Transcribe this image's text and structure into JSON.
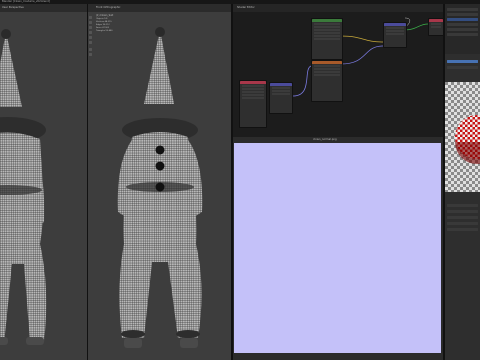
{
  "window": {
    "title": "Blender [Clown_Costume_v02.blend]"
  },
  "topbar": {
    "menus": [
      "File",
      "Edit",
      "Render",
      "Window",
      "Help"
    ],
    "workspaces": [
      "Layout",
      "Modeling",
      "Sculpting",
      "UV Editing",
      "Texture Paint",
      "Shading"
    ]
  },
  "viewport_left": {
    "label": "User Perspective",
    "object": "(1) Clown_Suit"
  },
  "viewport_right": {
    "label": "Front Orthographic",
    "object": "(1) Clown_Suit",
    "stats": [
      "Objects 1/6",
      "Vertices 48,215",
      "Edges 96,112",
      "Faces 47,902",
      "Triangles 95,480"
    ]
  },
  "node_editor": {
    "label": "Shader Editor",
    "nodes": [
      {
        "name": "Principled BSDF",
        "color": "#3b7a3b"
      },
      {
        "name": "Image Texture",
        "color": "#a85a2a"
      },
      {
        "name": "Normal Map",
        "color": "#4b4b9b"
      },
      {
        "name": "Mapping",
        "color": "#4b4b9b"
      },
      {
        "name": "Texture Coordinate",
        "color": "#a8374a"
      },
      {
        "name": "Material Output",
        "color": "#a8374a"
      }
    ]
  },
  "image_editor": {
    "label": "Image Editor",
    "image_name": "clown_normal.png"
  },
  "outliner": {
    "items": [
      "Scene Collection",
      "Collection",
      "Camera",
      "Clown_Hat",
      "Clown_Suit",
      "Light"
    ]
  },
  "properties": {
    "items": [
      "Surface",
      "Volume",
      "Displacement",
      "Settings",
      "Viewport Display"
    ]
  },
  "colors": {
    "accent": "#4772b3",
    "normal_map": "#c4c1f9",
    "checker_red": "#c81414"
  }
}
